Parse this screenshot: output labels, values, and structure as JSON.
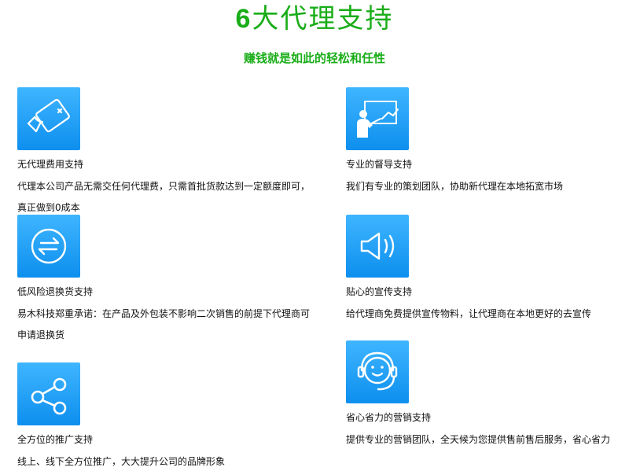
{
  "header": {
    "title_number": "6",
    "title_text": "大代理支持",
    "subtitle": "赚钱就是如此的轻松和任性"
  },
  "colors": {
    "accent_green": "#1aad19",
    "icon_blue": "#1e9ff7"
  },
  "features": [
    {
      "icon": "no-fee-card-icon",
      "title": "无代理费用支持",
      "desc": "代理本公司产品无需交任何代理费，只需首批货款达到一定额度即可，真正做到0成本"
    },
    {
      "icon": "teacher-board-icon",
      "title": "专业的督导支持",
      "desc": " 我们有专业的策划团队，协助新代理在本地拓宽市场"
    },
    {
      "icon": "exchange-arrows-icon",
      "title": "低风险退换货支持",
      "desc": "易木科技郑重承诺：在产品及外包装不影响二次销售的前提下代理商可申请退换货"
    },
    {
      "icon": "speaker-icon",
      "title": "贴心的宣传支持",
      "desc": "给代理商免费提供宣传物料，让代理商在本地更好的去宣传"
    },
    {
      "icon": "share-nodes-icon",
      "title": "全方位的推广支持",
      "desc": "线上、线下全方位推广，大大提升公司的品牌形象"
    },
    {
      "icon": "headset-agent-icon",
      "title": "省心省力的营销支持",
      "desc": "提供专业的营销团队，全天候为您提供售前售后服务，省心省力"
    }
  ]
}
